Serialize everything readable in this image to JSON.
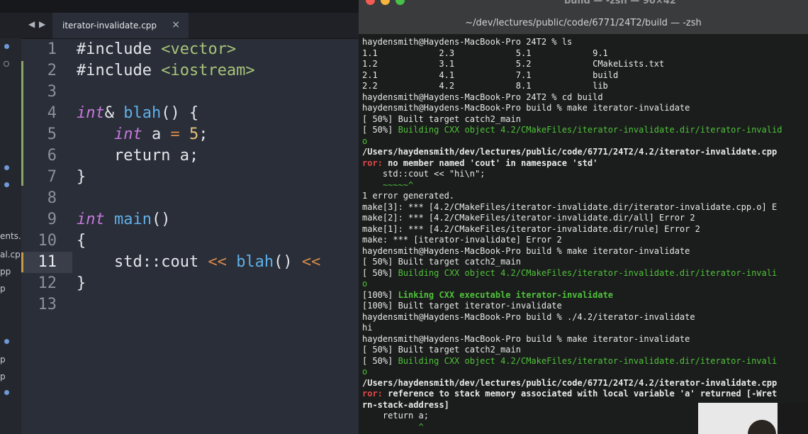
{
  "editor": {
    "tab_label": "iterator-invalidate.cpp",
    "tab_close": "×",
    "back_arrow": "◀",
    "forward_arrow": "▶",
    "sidebar_fragments": [
      "ents.",
      "al.cp",
      "pp",
      "p",
      "p",
      "p"
    ],
    "line_numbers": [
      "1",
      "2",
      "3",
      "4",
      "5",
      "6",
      "7",
      "8",
      "9",
      "10",
      "11",
      "12",
      "13"
    ],
    "current_line": "11",
    "code": {
      "l1_a": "#include ",
      "l1_b": "<vector>",
      "l2_a": "#include ",
      "l2_b": "<iostream>",
      "l4_a": "int",
      "l4_b": "& ",
      "l4_c": "blah",
      "l4_d": "() {",
      "l5_a": "    ",
      "l5_b": "int",
      "l5_c": " a ",
      "l5_d": "=",
      "l5_e": " ",
      "l5_f": "5",
      "l5_g": ";",
      "l6_a": "    ",
      "l6_b": "return",
      "l6_c": " a;",
      "l7": "}",
      "l9_a": "int",
      "l9_b": " ",
      "l9_c": "main",
      "l9_d": "()",
      "l10": "{",
      "l11_a": "    std::cout ",
      "l11_b": "<<",
      "l11_c": " ",
      "l11_d": "blah",
      "l11_e": "() ",
      "l11_f": "<<",
      "l12": "}"
    }
  },
  "terminal": {
    "window_title": "build — -zsh — 90×42",
    "window_subtitle": "~/dev/lectures/public/code/6771/24T2/build — -zsh",
    "lines": [
      "haydensmith@Haydens-MacBook-Pro 24T2 % ls",
      "1.1            2.3            5.1            9.1",
      "1.2            3.1            5.2            CMakeLists.txt",
      "2.1            4.1            7.1            build",
      "2.2            4.2            8.1            lib",
      "haydensmith@Haydens-MacBook-Pro 24T2 % cd build",
      "haydensmith@Haydens-MacBook-Pro build % make iterator-invalidate",
      "[ 50%] Built target catch2_main",
      "[ 50%] ",
      "Building CXX object 4.2/CMakeFiles/iterator-invalidate.dir/iterator-invalid",
      "o",
      "/Users/haydensmith/dev/lectures/public/code/6771/24T2/4.2/iterator-invalidate.cpp",
      "ror:",
      " no member named 'cout' in namespace 'std'",
      "    std::cout << \"hi\\n\";",
      "    ~~~~~^",
      "1 error generated.",
      "make[3]: *** [4.2/CMakeFiles/iterator-invalidate.dir/iterator-invalidate.cpp.o] E",
      "make[2]: *** [4.2/CMakeFiles/iterator-invalidate.dir/all] Error 2",
      "make[1]: *** [4.2/CMakeFiles/iterator-invalidate.dir/rule] Error 2",
      "make: *** [iterator-invalidate] Error 2",
      "haydensmith@Haydens-MacBook-Pro build % make iterator-invalidate",
      "[ 50%] Built target catch2_main",
      "[ 50%] ",
      "Building CXX object 4.2/CMakeFiles/iterator-invalidate.dir/iterator-invali",
      "o",
      "[100%] ",
      "Linking CXX executable iterator-invalidate",
      "[100%] Built target iterator-invalidate",
      "haydensmith@Haydens-MacBook-Pro build % ./4.2/iterator-invalidate",
      "hi",
      "haydensmith@Haydens-MacBook-Pro build % make iterator-invalidate",
      "[ 50%] Built target catch2_main",
      "[ 50%] ",
      "Building CXX object 4.2/CMakeFiles/iterator-invalidate.dir/iterator-invali",
      "o",
      "/Users/haydensmith/dev/lectures/public/code/6771/24T2/4.2/iterator-invalidate.cpp",
      "ror:",
      " reference to stack memory associated with local variable 'a' returned [-Wret",
      "rn-stack-address]",
      "    return a;",
      "           ^"
    ]
  },
  "colors": {
    "editor_bg": "#2a2e38",
    "terminal_bg": "#1b1c1c",
    "green_output": "#4fc23a",
    "error_red": "#e04a4a",
    "keyword_purple": "#c678dd",
    "function_blue": "#5fb0e8",
    "number_yellow": "#e5c07b"
  }
}
